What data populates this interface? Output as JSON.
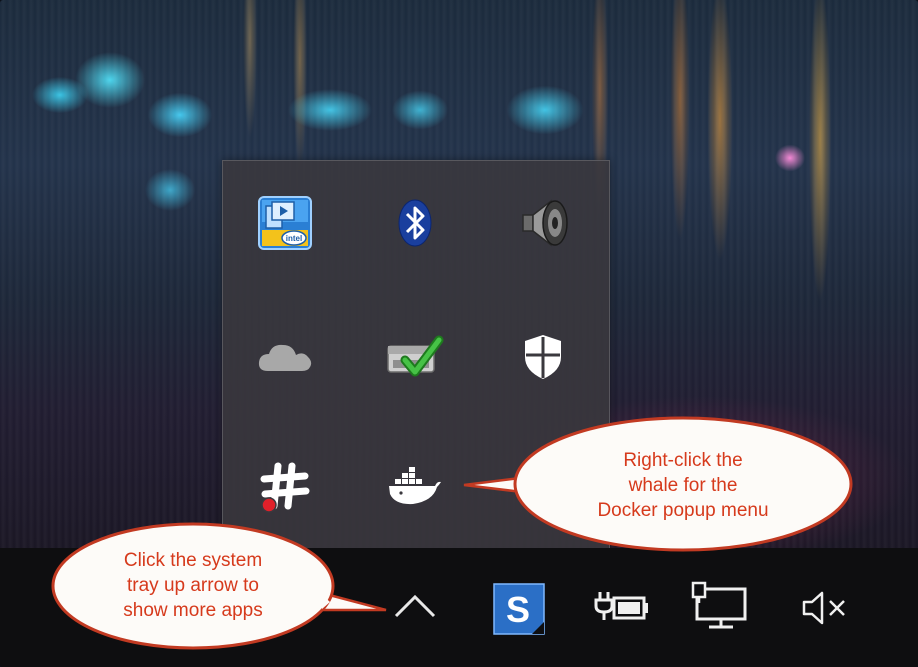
{
  "tray_popup": {
    "icons": [
      {
        "name": "intel-graphics-icon"
      },
      {
        "name": "bluetooth-icon"
      },
      {
        "name": "speaker-icon"
      },
      {
        "name": "onedrive-cloud-icon"
      },
      {
        "name": "sync-check-icon"
      },
      {
        "name": "windows-defender-shield-icon"
      },
      {
        "name": "slack-icon"
      },
      {
        "name": "docker-whale-icon"
      }
    ]
  },
  "taskbar": {
    "items": [
      {
        "name": "tray-up-arrow-icon"
      },
      {
        "name": "snagit-icon",
        "glyph": "S"
      },
      {
        "name": "battery-power-icon"
      },
      {
        "name": "network-display-icon"
      },
      {
        "name": "volume-muted-icon"
      }
    ]
  },
  "callouts": {
    "docker": {
      "lines": [
        "Right-click the",
        "whale for the",
        "Docker popup menu"
      ]
    },
    "tray": {
      "lines": [
        "Click the system",
        "tray up arrow to",
        "show more apps"
      ]
    }
  },
  "colors": {
    "callout_fill": "#fdfbf8",
    "callout_border": "#c23a22",
    "callout_text": "#d63a1c",
    "taskbar": "#0e0e10",
    "popup": "#3a383e"
  }
}
